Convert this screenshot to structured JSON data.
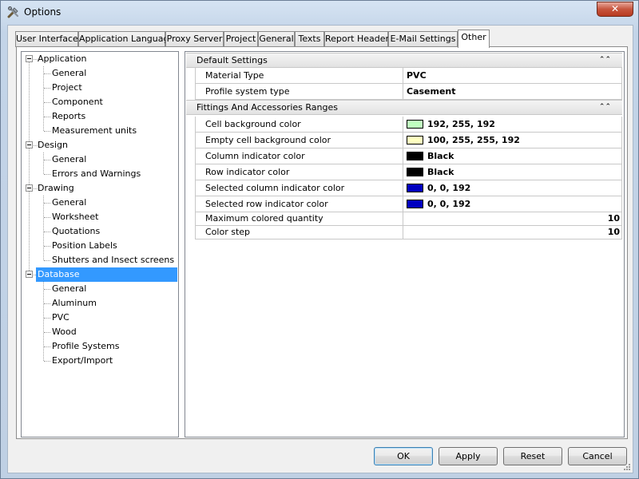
{
  "window": {
    "title": "Options",
    "close_glyph": "✕"
  },
  "tabs": [
    {
      "label": "User Interface",
      "active": false
    },
    {
      "label": "Application Language",
      "active": false
    },
    {
      "label": "Proxy Server",
      "active": false
    },
    {
      "label": "Project",
      "active": false
    },
    {
      "label": "General",
      "active": false
    },
    {
      "label": "Texts",
      "active": false
    },
    {
      "label": "Report Header",
      "active": false
    },
    {
      "label": "E-Mail Settings",
      "active": false
    },
    {
      "label": "Other",
      "active": true
    }
  ],
  "tree": {
    "groups": [
      {
        "label": "Application",
        "children": [
          "General",
          "Project",
          "Component",
          "Reports",
          "Measurement units"
        ]
      },
      {
        "label": "Design",
        "children": [
          "General",
          "Errors and Warnings"
        ]
      },
      {
        "label": "Drawing",
        "children": [
          "General",
          "Worksheet",
          "Quotations",
          "Position Labels",
          "Shutters and Insect screens"
        ]
      },
      {
        "label": "Database",
        "selected": true,
        "children": [
          "General",
          "Aluminum",
          "PVC",
          "Wood",
          "Profile Systems",
          "Export/Import"
        ]
      }
    ]
  },
  "grid": {
    "categories": [
      {
        "label": "Default Settings",
        "rows": [
          {
            "name": "Material Type",
            "value": "PVC"
          },
          {
            "name": "Profile system type",
            "value": "Casement"
          }
        ]
      },
      {
        "label": "Fittings And Accessories Ranges",
        "rows": [
          {
            "name": "Cell background color",
            "value": "192, 255, 192",
            "swatch": "#c0ffc0"
          },
          {
            "name": "Empty cell background color",
            "value": "100, 255, 255, 192",
            "swatch": "#ffffc0"
          },
          {
            "name": "Column indicator color",
            "value": "Black",
            "swatch": "#000000"
          },
          {
            "name": "Row indicator color",
            "value": "Black",
            "swatch": "#000000"
          },
          {
            "name": "Selected column indicator color",
            "value": "0, 0, 192",
            "swatch": "#0000c0"
          },
          {
            "name": "Selected row indicator color",
            "value": "0, 0, 192",
            "swatch": "#0000c0"
          },
          {
            "name": "Maximum colored quantity",
            "value": "10",
            "numeric": true
          },
          {
            "name": "Color step",
            "value": "10",
            "numeric": true
          }
        ]
      }
    ],
    "collapse_glyph": "⌃⌃"
  },
  "buttons": {
    "ok": "OK",
    "apply": "Apply",
    "reset": "Reset",
    "cancel": "Cancel"
  },
  "colors": {
    "selection": "#3399ff",
    "close_button": "#c7553e"
  }
}
